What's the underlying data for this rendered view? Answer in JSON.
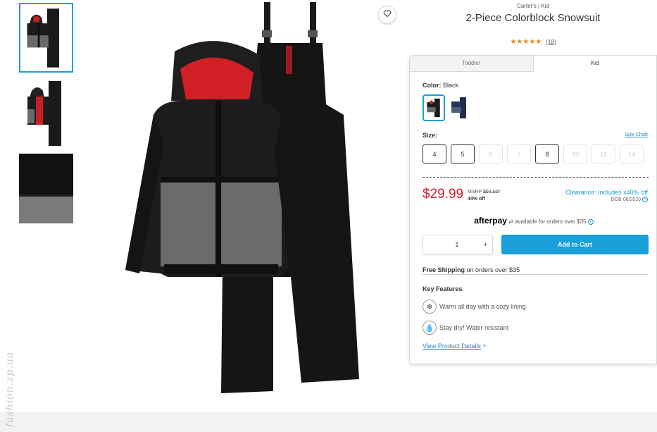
{
  "watermark": "fashion.zp.ua",
  "favorite": {
    "icon": "heart-icon"
  },
  "product": {
    "brand": "Carter's | Kid",
    "title": "2-Piece Colorblock Snowsuit",
    "rating": 4.5,
    "stars": "★★★★★",
    "review_count": "(18)"
  },
  "tabs": [
    {
      "label": "Toddler",
      "active": false
    },
    {
      "label": "Kid",
      "active": true
    }
  ],
  "color": {
    "label": "Color:",
    "value": "Black"
  },
  "size": {
    "label": "Size:",
    "chart_link": "Size Chart",
    "options": [
      {
        "label": "4",
        "available": true
      },
      {
        "label": "5",
        "available": true
      },
      {
        "label": "6",
        "available": false
      },
      {
        "label": "7",
        "available": false
      },
      {
        "label": "8",
        "available": true
      },
      {
        "label": "10",
        "available": false
      },
      {
        "label": "12",
        "available": false
      },
      {
        "label": "14",
        "available": false
      }
    ]
  },
  "pricing": {
    "price": "$29.99",
    "msrp_label": "MSRP",
    "msrp_value": "$54.00*",
    "discount": "44% off",
    "clearance": "Clearance: Includes x40% off",
    "dob": "DOB 06/2020"
  },
  "afterpay": {
    "logo": "afterpay",
    "text": "available for orders over $35"
  },
  "quantity": {
    "minus": "-",
    "value": "1",
    "plus": "+"
  },
  "add_to_cart": "Add to Cart",
  "shipping": {
    "bold": "Free Shipping",
    "rest": "on orders over $35"
  },
  "key_features": {
    "title": "Key Features",
    "items": [
      {
        "icon": "snowflake-icon",
        "text": "Warm all day with a cozy lining"
      },
      {
        "icon": "water-drop-icon",
        "text": "Stay dry! Water resistant"
      }
    ]
  },
  "details_link": "View Product Details",
  "details_plus": "+",
  "colors": {
    "accent": "#1a9fd8",
    "price": "#d81e2a",
    "star": "#e08a1e"
  }
}
